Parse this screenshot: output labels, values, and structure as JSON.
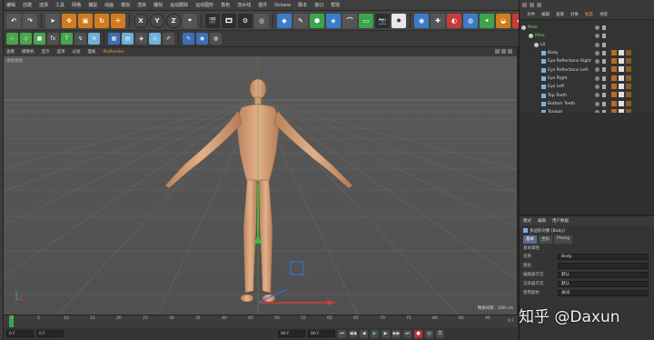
{
  "menu": [
    "编辑",
    "创建",
    "选择",
    "工具",
    "网格",
    "捕捉",
    "动画",
    "模拟",
    "渲染",
    "雕刻",
    "运动跟踪",
    "运动图形",
    "角色",
    "流水线",
    "插件",
    "Octane",
    "脚本",
    "窗口",
    "帮助"
  ],
  "toolbar_axes": [
    "X",
    "Y",
    "Z"
  ],
  "viewport": {
    "menu": [
      "查看",
      "摄像机",
      "显示",
      "选项",
      "过滤",
      "面板",
      "ProRender"
    ],
    "active_menu": "ProRender",
    "label": "透视视图",
    "scale_label": "网格间距 : 100 cm"
  },
  "timeline": {
    "ticks": [
      "0",
      "5",
      "10",
      "15",
      "20",
      "25",
      "30",
      "35",
      "40",
      "45",
      "50",
      "55",
      "60",
      "65",
      "70",
      "75",
      "80",
      "85",
      "90"
    ],
    "frame_label": "0 F"
  },
  "playback": {
    "start_field": "0 F",
    "current_field": "0 F",
    "end_field": "90 F",
    "max_field": "90 F"
  },
  "right_panel": {
    "menu": [
      "文件",
      "编辑",
      "查看",
      "对象",
      "标签",
      "书签"
    ],
    "active_menu": "标签",
    "objects": [
      {
        "name": "Male",
        "indent": 2,
        "icon": "null",
        "green": true
      },
      {
        "name": "Male",
        "indent": 10,
        "icon": "null",
        "green": true
      },
      {
        "name": "L0",
        "indent": 16,
        "icon": "null",
        "green": false
      },
      {
        "name": "Body",
        "indent": 24,
        "icon": "bone",
        "green": false
      },
      {
        "name": "Eye Reflections Right",
        "indent": 24,
        "icon": "bone",
        "green": false
      },
      {
        "name": "Eye Reflections Left",
        "indent": 24,
        "icon": "bone",
        "green": false
      },
      {
        "name": "Eye Right",
        "indent": 24,
        "icon": "bone",
        "green": false
      },
      {
        "name": "Eye Left",
        "indent": 24,
        "icon": "bone",
        "green": false
      },
      {
        "name": "Top Teeth",
        "indent": 24,
        "icon": "bone",
        "green": false
      },
      {
        "name": "Bottom Teeth",
        "indent": 24,
        "icon": "bone",
        "green": false
      },
      {
        "name": "Tongue",
        "indent": 24,
        "icon": "bone",
        "green": false
      }
    ]
  },
  "attributes": {
    "menu": [
      "模式",
      "编辑",
      "用户数据"
    ],
    "header": "多边形对象 [Body]",
    "tabs": [
      "基本",
      "坐标",
      "Phong"
    ],
    "active_tab": "基本",
    "section": "基本属性",
    "rows": [
      {
        "label": "名称",
        "value": "Body"
      },
      {
        "label": "图层",
        "value": ""
      },
      {
        "label": "编辑器可见",
        "value": "默认"
      },
      {
        "label": "渲染器可见",
        "value": "默认"
      },
      {
        "label": "使用颜色",
        "value": "关闭"
      }
    ]
  },
  "watermark": "知乎 @Daxun",
  "colors": {
    "accent": "#e5a64a",
    "skin": "#d9a278",
    "grid": "#6a6a6a"
  }
}
